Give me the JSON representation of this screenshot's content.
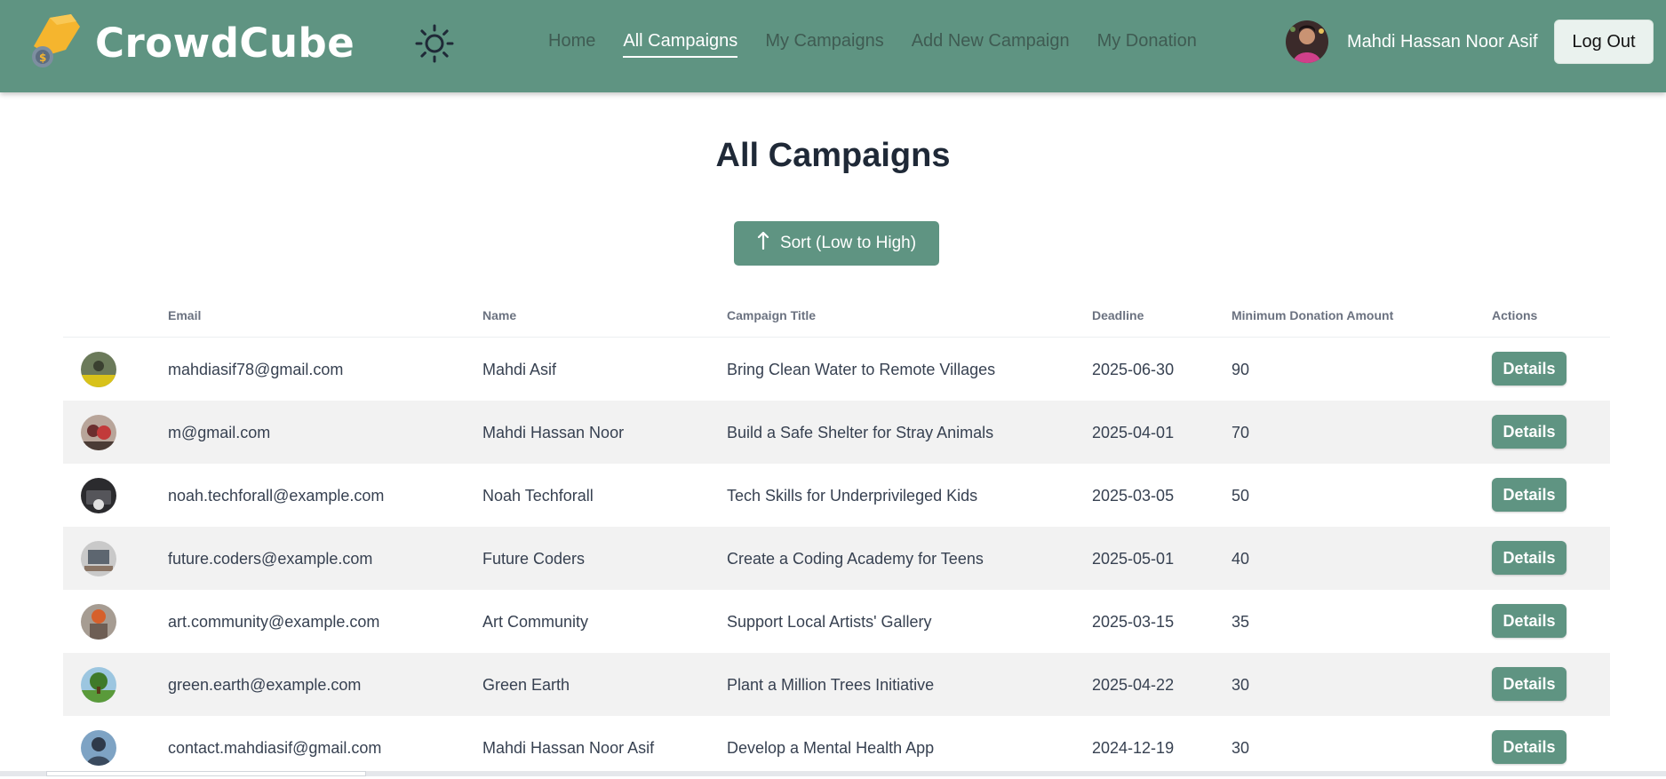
{
  "brand": {
    "name": "CrowdCube"
  },
  "nav": {
    "links": [
      {
        "label": "Home",
        "active": false
      },
      {
        "label": "All Campaigns",
        "active": true
      },
      {
        "label": "My Campaigns",
        "active": false
      },
      {
        "label": "Add New Campaign",
        "active": false
      },
      {
        "label": "My Donation",
        "active": false
      }
    ],
    "user_name": "Mahdi Hassan Noor Asif",
    "logout_label": "Log Out",
    "theme_icon": "sun-icon"
  },
  "main": {
    "title": "All Campaigns",
    "sort_label": "Sort (Low to High)",
    "sort_icon": "arrow-up-icon"
  },
  "table": {
    "headers": [
      "Email",
      "Name",
      "Campaign Title",
      "Deadline",
      "Minimum Donation Amount",
      "Actions"
    ],
    "rows": [
      {
        "email": "mahdiasif78@gmail.com",
        "name": "Mahdi Asif",
        "title": "Bring Clean Water to Remote Villages",
        "deadline": "2025-06-30",
        "min": "90",
        "action": "Details"
      },
      {
        "email": "m@gmail.com",
        "name": "Mahdi Hassan Noor",
        "title": "Build a Safe Shelter for Stray Animals",
        "deadline": "2025-04-01",
        "min": "70",
        "action": "Details"
      },
      {
        "email": "noah.techforall@example.com",
        "name": "Noah Techforall",
        "title": "Tech Skills for Underprivileged Kids",
        "deadline": "2025-03-05",
        "min": "50",
        "action": "Details"
      },
      {
        "email": "future.coders@example.com",
        "name": "Future Coders",
        "title": "Create a Coding Academy for Teens",
        "deadline": "2025-05-01",
        "min": "40",
        "action": "Details"
      },
      {
        "email": "art.community@example.com",
        "name": "Art Community",
        "title": "Support Local Artists' Gallery",
        "deadline": "2025-03-15",
        "min": "35",
        "action": "Details"
      },
      {
        "email": "green.earth@example.com",
        "name": "Green Earth",
        "title": "Plant a Million Trees Initiative",
        "deadline": "2025-04-22",
        "min": "30",
        "action": "Details"
      },
      {
        "email": "contact.mahdiasif@gmail.com",
        "name": "Mahdi Hassan Noor Asif",
        "title": "Develop a Mental Health App",
        "deadline": "2024-12-19",
        "min": "30",
        "action": "Details"
      }
    ]
  },
  "colors": {
    "primary": "#5f9482",
    "nav_text": "#3f5b52",
    "alt_row": "#f2f2f2"
  }
}
